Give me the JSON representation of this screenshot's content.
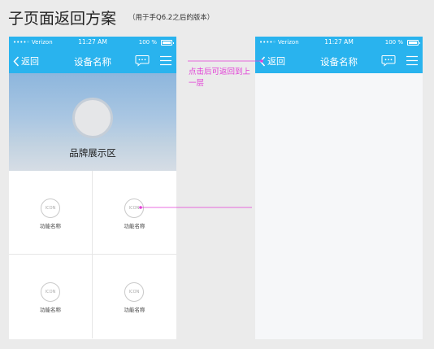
{
  "doc": {
    "title": "子页面返回方案",
    "subtitle": "（用于手Q6.2之后的版本）"
  },
  "status_bar": {
    "carrier": "••••◦ Verizon",
    "time": "11:27 AM",
    "battery": "100 %"
  },
  "left_phone": {
    "back_label": "返回",
    "title": "设备名称",
    "brand_label": "品牌展示区",
    "cells": [
      {
        "icon_text": "ICON",
        "label": "功能名称"
      },
      {
        "icon_text": "ICON",
        "label": "功能名称"
      },
      {
        "icon_text": "ICON",
        "label": "功能名称"
      },
      {
        "icon_text": "ICON",
        "label": "功能名称"
      }
    ]
  },
  "right_phone": {
    "back_label": "返回",
    "title": "设备名称"
  },
  "annotation": {
    "text": "点击后可返回到上一层",
    "color": "#e23fd6"
  },
  "colors": {
    "accent": "#29b3ee",
    "annotation": "#e23fd6"
  },
  "icons": [
    "chevron-left-icon",
    "chat-icon",
    "menu-icon",
    "wifi-icon",
    "battery-icon"
  ]
}
